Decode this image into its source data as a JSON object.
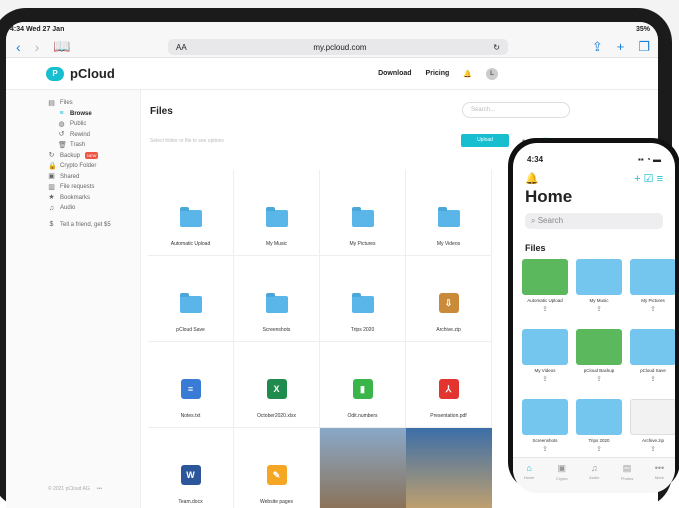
{
  "ipad_status": {
    "time": "4:34  Wed 27 Jan",
    "battery": "35%"
  },
  "safari": {
    "aa": "AA",
    "url": "my.pcloud.com"
  },
  "topnav": {
    "logo_text": "pCloud",
    "download": "Download",
    "pricing": "Pricing",
    "avatar": "L"
  },
  "sidebar": {
    "items": [
      {
        "label": "Files"
      },
      {
        "label": "Browse"
      },
      {
        "label": "Public"
      },
      {
        "label": "Rewind"
      },
      {
        "label": "Trash"
      },
      {
        "label": "Backup",
        "badge": "NEW"
      },
      {
        "label": "Crypto Folder"
      },
      {
        "label": "Shared"
      },
      {
        "label": "File requests"
      },
      {
        "label": "Bookmarks"
      },
      {
        "label": "Audio"
      },
      {
        "label": "Tell a friend, get $5"
      }
    ],
    "copyright": "© 2021 pCloud AG",
    "more": "•••"
  },
  "main": {
    "title": "Files",
    "search_placeholder": "Search...",
    "select_hint": "Select folder or file to see options",
    "upload": "Upload",
    "files": [
      {
        "name": "Automatic Upload",
        "kind": "folder"
      },
      {
        "name": "My Music",
        "kind": "folder"
      },
      {
        "name": "My Pictures",
        "kind": "folder"
      },
      {
        "name": "My Videos",
        "kind": "folder"
      },
      {
        "name": "pCloud Save",
        "kind": "folder"
      },
      {
        "name": "Screenshots",
        "kind": "folder"
      },
      {
        "name": "Trips 2020",
        "kind": "folder"
      },
      {
        "name": "Archive.zip",
        "kind": "archive"
      },
      {
        "name": "Notes.txt",
        "kind": "txt"
      },
      {
        "name": "October2020.xlsx",
        "kind": "xlsx"
      },
      {
        "name": "Odit.numbers",
        "kind": "numbers"
      },
      {
        "name": "Presentation.pdf",
        "kind": "pdf"
      },
      {
        "name": "Team.docx",
        "kind": "docx"
      },
      {
        "name": "Website pages",
        "kind": "pages"
      },
      {
        "name": "",
        "kind": "photo"
      },
      {
        "name": "",
        "kind": "photo"
      }
    ]
  },
  "iphone": {
    "time": "4:34",
    "title": "Home",
    "search": "Search",
    "section": "Files",
    "files": [
      {
        "name": "Automatic Upload",
        "kind": "green"
      },
      {
        "name": "My Music",
        "kind": "folder"
      },
      {
        "name": "My Pictures",
        "kind": "folder"
      },
      {
        "name": "My Videos",
        "kind": "folder"
      },
      {
        "name": "pCloud Backup",
        "kind": "green"
      },
      {
        "name": "pCloud Save",
        "kind": "folder"
      },
      {
        "name": "Screenshots",
        "kind": "folder"
      },
      {
        "name": "Trips 2020",
        "kind": "folder"
      },
      {
        "name": "Archive.zip",
        "kind": "archive"
      }
    ],
    "tabs": [
      "Home",
      "Crypto",
      "Audio",
      "Photos",
      "More"
    ]
  }
}
